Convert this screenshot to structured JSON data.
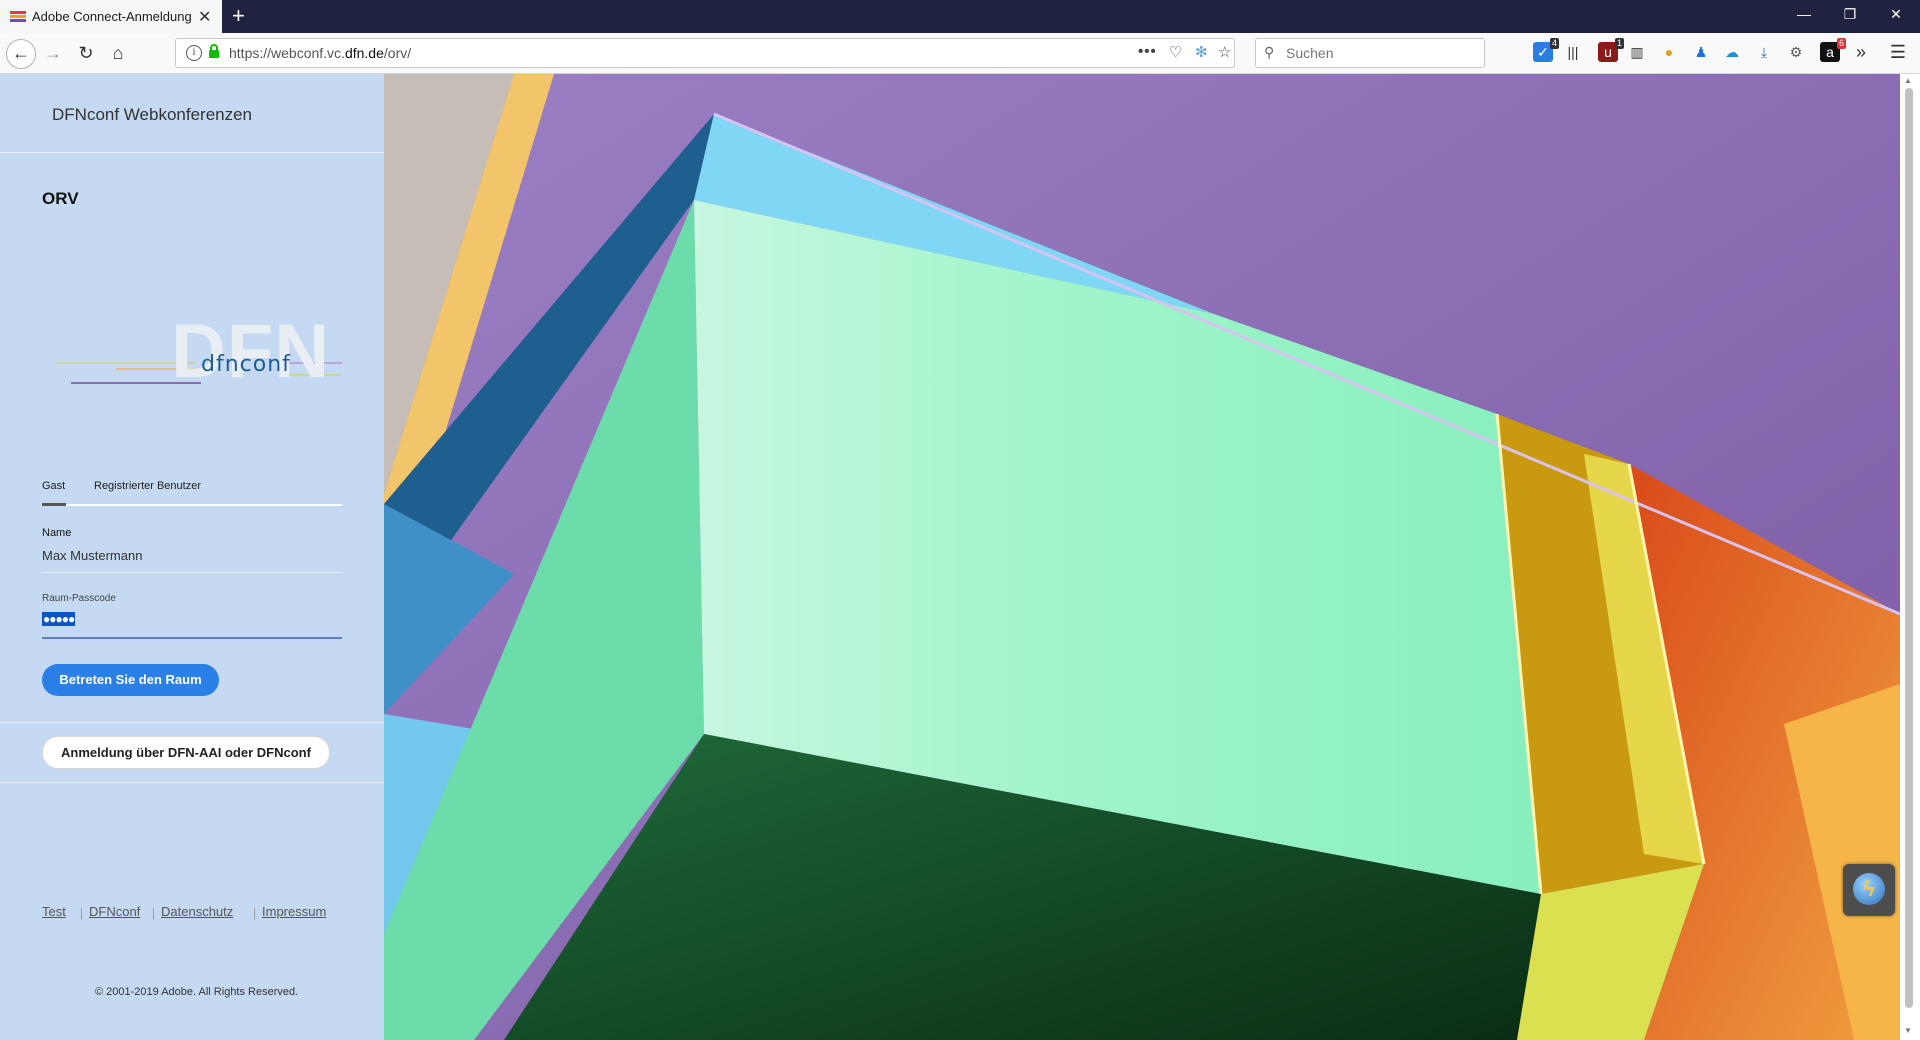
{
  "browser": {
    "tab_title": "Adobe Connect-Anmeldung",
    "tab_close": "✕",
    "new_tab": "+",
    "window_controls": {
      "minimize": "—",
      "restore": "❐",
      "close": "✕"
    },
    "nav": {
      "back": "←",
      "forward": "→",
      "reload": "↻",
      "home": "⌂"
    },
    "url": {
      "prefix": "https://webconf.vc.",
      "domain": "dfn.de",
      "path": "/orv/"
    },
    "page_actions": "•••",
    "search_placeholder": "Suchen",
    "extension_badges": {
      "first": "4",
      "second": "1",
      "third": "6"
    }
  },
  "sidebar": {
    "brand_title": "DFNconf Webkonferenzen",
    "room_name": "ORV",
    "logo": {
      "big": "DFN",
      "small": "dfnconf"
    },
    "tabs": {
      "guest": "Gast",
      "registered": "Registrierter Benutzer"
    },
    "form": {
      "name_label": "Name",
      "name_value": "Max Mustermann",
      "passcode_label": "Raum-Passcode",
      "passcode_value": "●●●●●"
    },
    "enter_button": "Betreten Sie den Raum",
    "aai_button": "Anmeldung über DFN-AAI oder DFNconf",
    "footer_links": [
      "Test",
      "DFNconf",
      "Datenschutz",
      "Impressum"
    ],
    "copyright": "© 2001-2019 Adobe. All Rights Reserved."
  },
  "colors": {
    "sidebar_bg": "#c5daf2",
    "primary_button": "#2a80e6",
    "titlebar": "#1f2340"
  }
}
